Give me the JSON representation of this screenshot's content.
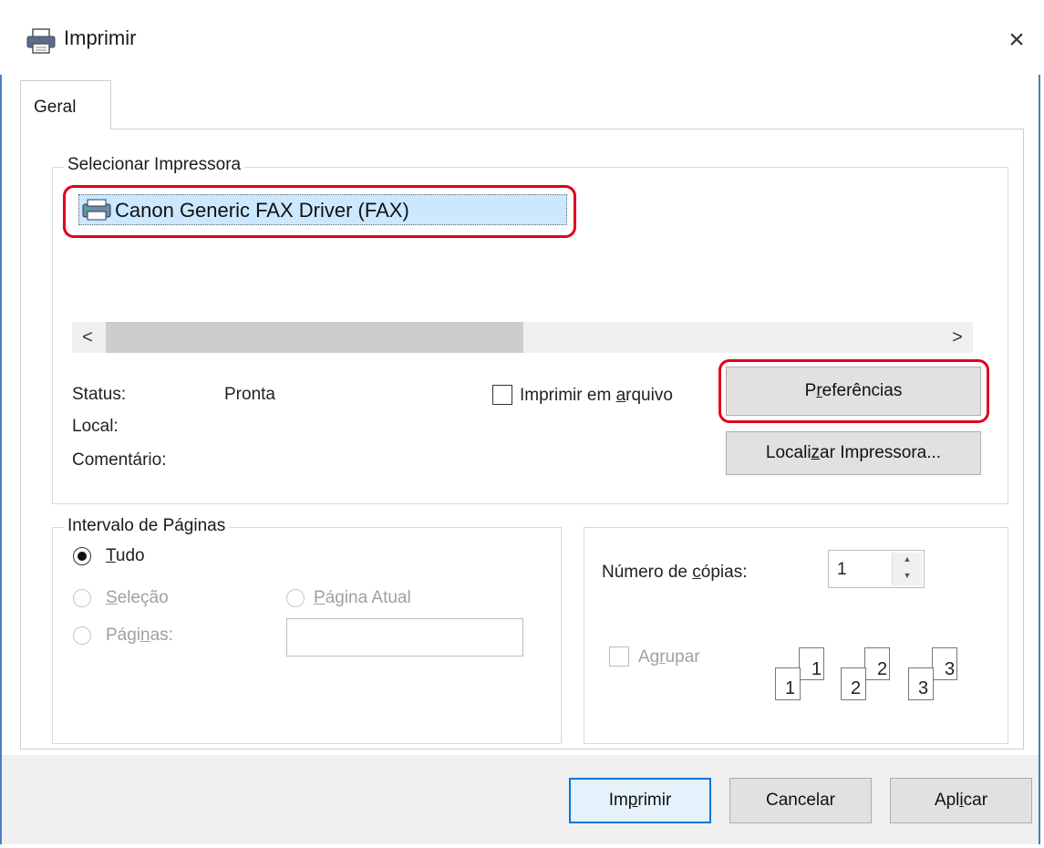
{
  "window": {
    "title": "Imprimir",
    "close_glyph": "×",
    "title_icon": "printer-icon"
  },
  "tabs": [
    {
      "label": "Geral",
      "active": true
    }
  ],
  "select_printer": {
    "legend": "Selecionar Impressora",
    "printers": [
      {
        "name": "Canon Generic FAX Driver (FAX)",
        "icon": "fax-printer-icon",
        "selected": true
      }
    ],
    "scroll_left_glyph": "<",
    "scroll_right_glyph": ">",
    "status_label": "Status:",
    "status_value": "Pronta",
    "location_label": "Local:",
    "location_value": "",
    "comment_label": "Comentário:",
    "comment_value": "",
    "print_to_file": {
      "pre": "Imprimir em ",
      "key": "a",
      "post": "rquivo",
      "checked": false
    },
    "preferences": {
      "pre": "P",
      "key": "r",
      "post": "eferências"
    },
    "find_printer": {
      "pre": "Locali",
      "key": "z",
      "post": "ar Impressora..."
    }
  },
  "page_range": {
    "legend": "Intervalo de Páginas",
    "all": {
      "pre": "",
      "key": "T",
      "post": "udo",
      "checked": true
    },
    "selection": {
      "pre": "",
      "key": "S",
      "post": "eleção",
      "enabled": false
    },
    "current_page": {
      "pre": "",
      "key": "P",
      "post": "ágina Atual",
      "enabled": false
    },
    "pages": {
      "pre": "Pági",
      "key": "n",
      "post": "as:",
      "enabled": false,
      "value": ""
    }
  },
  "copies": {
    "label": {
      "pre": "Número de ",
      "key": "c",
      "post": "ópias:"
    },
    "value": "1",
    "spin_up": "▲",
    "spin_down": "▼",
    "collate": {
      "pre": "Ag",
      "key": "r",
      "post": "upar",
      "checked": false,
      "enabled": false
    },
    "collate_sets": [
      {
        "back": "1",
        "front": "1"
      },
      {
        "back": "2",
        "front": "2"
      },
      {
        "back": "3",
        "front": "3"
      }
    ]
  },
  "footer": {
    "print": {
      "pre": "Im",
      "key": "p",
      "post": "rimir"
    },
    "cancel": {
      "pre": "Cancelar",
      "key": "",
      "post": ""
    },
    "apply": {
      "pre": "Apl",
      "key": "i",
      "post": "car"
    }
  },
  "colors": {
    "highlight_ring": "#e0001b",
    "selection_bg": "#cce8ff",
    "window_border": "#4a7fc0",
    "dialog_bg": "#f0f0f0"
  }
}
